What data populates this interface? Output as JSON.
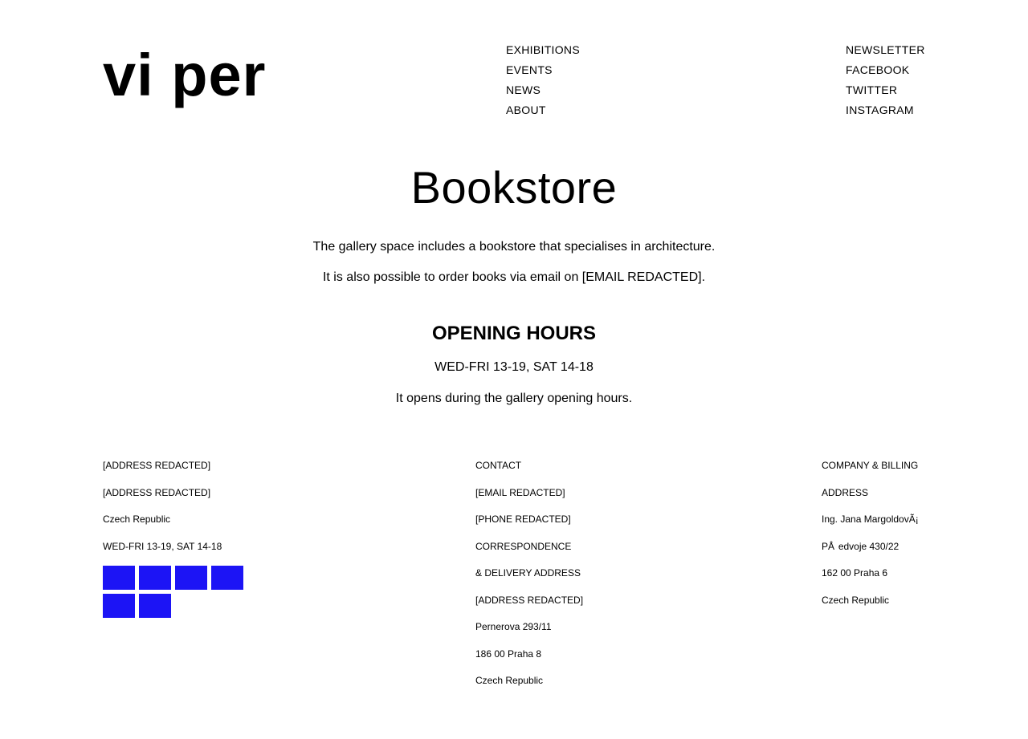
{
  "header": {
    "logo": "vi per",
    "nav": [
      "EXHIBITIONS",
      "EVENTS",
      "NEWS",
      "ABOUT"
    ],
    "social": [
      "NEWSLETTER",
      "FACEBOOK",
      "TWITTER",
      "INSTAGRAM"
    ]
  },
  "main": {
    "title": "Bookstore",
    "intro": "The gallery space includes a bookstore that specialises in architecture.",
    "order_note": "It is also possible to order books via email on [EMAIL REDACTED].",
    "hours_heading": "OPENING HOURS",
    "hours": "WED-FRI 13-19, SAT 14-18",
    "hours_note": "It opens during the gallery opening hours."
  },
  "footer": {
    "address": [
      "[ADDRESS REDACTED]",
      "[ADDRESS REDACTED]",
      "Czech Republic",
      "WED-FRI 13-19, SAT 14-18"
    ],
    "contact": [
      "CONTACT",
      "[EMAIL REDACTED]",
      "[PHONE REDACTED]",
      "CORRESPONDENCE",
      "& DELIVERY ADDRESS",
      "[ADDRESS REDACTED]",
      "Pernerova 293/11",
      "186 00 Praha 8",
      "Czech Republic"
    ],
    "billing": [
      "COMPANY & BILLING",
      "ADDRESS",
      "Ing. Jana MargoldovÃ¡",
      "PÅ  edvoje 430/22",
      "162 00 Praha 6",
      "Czech Republic"
    ],
    "square_color": "#1c14f5"
  }
}
